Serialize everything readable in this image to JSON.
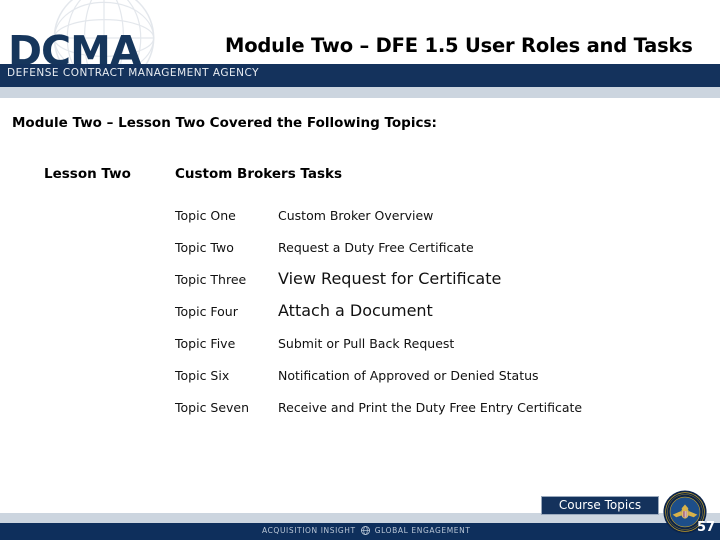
{
  "header": {
    "logo_wordmark": "DCMA",
    "agency_bar_text": "DEFENSE CONTRACT MANAGEMENT AGENCY",
    "title": "Module Two – DFE 1.5 User Roles and Tasks",
    "navy_color": "#14325c",
    "light_band_color": "#ccd5df"
  },
  "body": {
    "subtitle": "Module Two – Lesson Two Covered the Following Topics:",
    "lesson_label": "Lesson Two",
    "lesson_value": "Custom Brokers Tasks",
    "topics": [
      {
        "key": "Topic One",
        "desc": "Custom Broker Overview"
      },
      {
        "key": "Topic Two",
        "desc": "Request a Duty Free Certificate"
      },
      {
        "key": "Topic Three",
        "desc": "View Request for Certificate"
      },
      {
        "key": "Topic Four",
        "desc": "Attach a Document"
      },
      {
        "key": "Topic Five",
        "desc": "Submit or Pull Back Request"
      },
      {
        "key": "Topic Six",
        "desc": "Notification of Approved or Denied Status"
      },
      {
        "key": "Topic Seven",
        "desc": "Receive and Print the Duty Free Entry Certificate"
      }
    ]
  },
  "footer": {
    "tagline_left": "ACQUISITION INSIGHT",
    "tagline_right": "GLOBAL ENGAGEMENT",
    "course_topics_label": "Course Topics",
    "page_number": "57",
    "navy_color": "#0e2f5c",
    "light_band_color": "#ccd5df"
  }
}
